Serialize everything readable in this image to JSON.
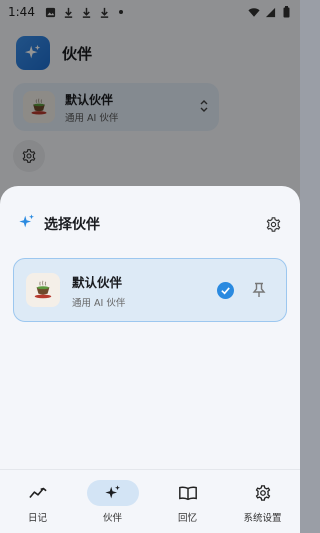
{
  "status_bar": {
    "time": "1:44"
  },
  "background_screen": {
    "app_title": "伙伴",
    "current_partner": {
      "name": "默认伙伴",
      "subtitle": "通用 AI 伙伴"
    }
  },
  "sheet": {
    "title": "选择伙伴",
    "partners": [
      {
        "name": "默认伙伴",
        "subtitle": "通用 AI 伙伴",
        "selected": true
      }
    ]
  },
  "bottom_nav": {
    "items": [
      {
        "label": "日记",
        "icon": "trend-line-icon",
        "active": false
      },
      {
        "label": "伙伴",
        "icon": "sparkle-icon",
        "active": true
      },
      {
        "label": "回忆",
        "icon": "open-book-icon",
        "active": false
      },
      {
        "label": "系统设置",
        "icon": "gear-icon",
        "active": false
      }
    ]
  },
  "colors": {
    "accent": "#2a8ae0",
    "selected_card_bg": "#ddeaf6",
    "selected_card_border": "#9cc7ef",
    "active_nav_pill": "#d3e4f5"
  }
}
